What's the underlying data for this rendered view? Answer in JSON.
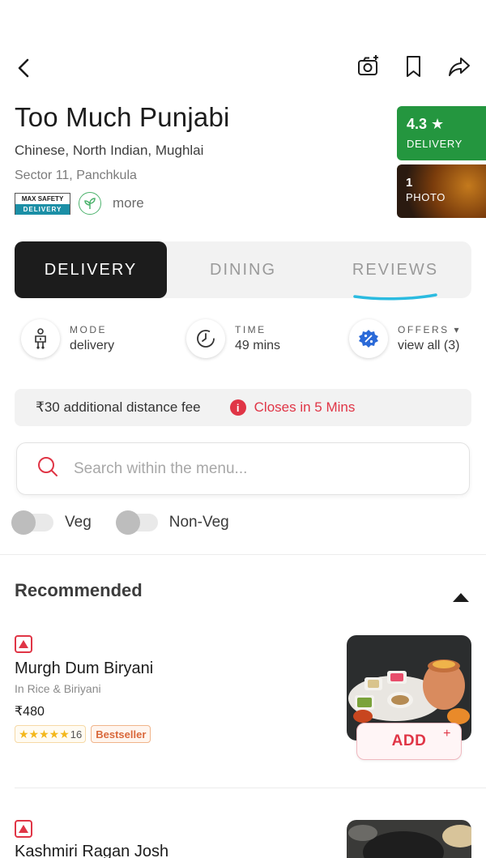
{
  "restaurant": {
    "name": "Too Much Punjabi",
    "cuisines": "Chinese, North Indian, Mughlai",
    "location": "Sector 11, Panchkula",
    "safety_badge_top": "MAX SAFETY",
    "safety_badge_bottom": "DELIVERY",
    "more_label": "more",
    "rating": "4.3 ★",
    "rating_label": "DELIVERY",
    "photo_count": "1",
    "photo_label": "PHOTO"
  },
  "tabs": [
    {
      "label": "DELIVERY",
      "active": true
    },
    {
      "label": "DINING",
      "active": false
    },
    {
      "label": "REVIEWS",
      "active": false
    }
  ],
  "modes": {
    "mode": {
      "title": "MODE",
      "value": "delivery"
    },
    "time": {
      "title": "TIME",
      "value": "49 mins"
    },
    "offers": {
      "title": "OFFERS ▾",
      "value": "view all (3)"
    }
  },
  "notice": {
    "fee": "₹30 additional distance fee",
    "closing": "Closes in 5 Mins",
    "info_glyph": "i"
  },
  "search": {
    "placeholder": "Search within the menu..."
  },
  "filters": {
    "veg": "Veg",
    "nonveg": "Non-Veg"
  },
  "section": {
    "title": "Recommended"
  },
  "items": [
    {
      "name": "Murgh Dum Biryani",
      "category": "In Rice & Biriyani",
      "price": "₹480",
      "stars": "★★★★★",
      "rating_count": "16",
      "badge": "Bestseller",
      "add_label": "ADD",
      "add_plus": "+"
    },
    {
      "name": "Kashmiri Ragan Josh"
    }
  ],
  "colors": {
    "brand_red": "#e03546",
    "rating_green": "#24963f",
    "tab_active_bg": "#1c1c1c",
    "underline_cyan": "#2bbbe0"
  },
  "icons": {
    "back": "chevron-left-icon",
    "camera": "camera-add-icon",
    "bookmark": "bookmark-icon",
    "share": "share-arrow-icon",
    "search": "search-icon"
  }
}
